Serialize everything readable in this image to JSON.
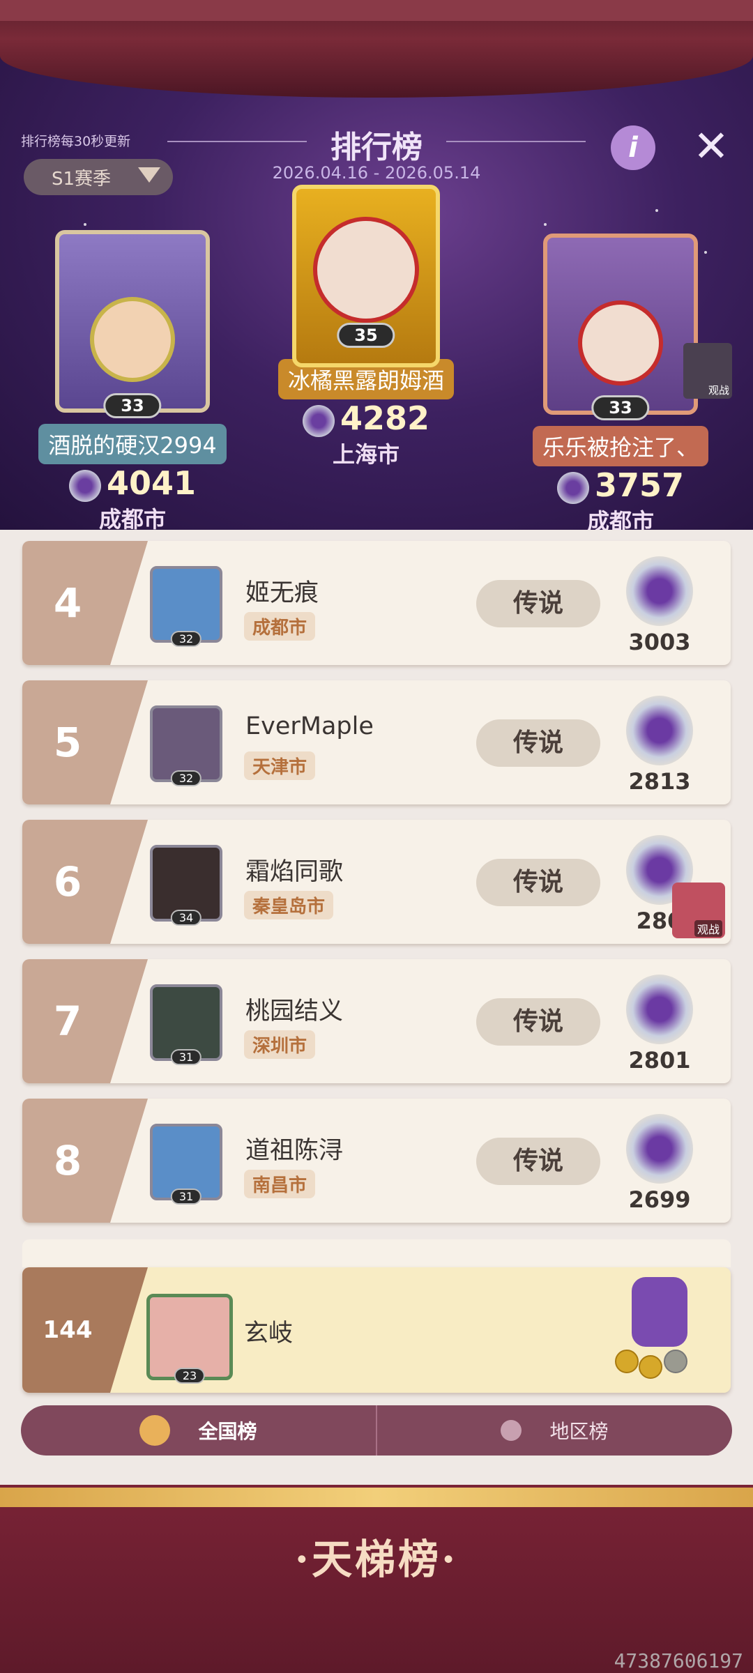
{
  "header": {
    "update_note": "排行榜每30秒更新",
    "season": "S1赛季",
    "title": "排行榜",
    "date_range": "2026.04.16 - 2026.05.14",
    "info_label": "i",
    "close_label": "✕"
  },
  "podium": [
    {
      "rank": "2",
      "name": "酒脱的硬汉2994",
      "level": "33",
      "score": "4041",
      "city": "成都市"
    },
    {
      "rank": "1",
      "name": "冰橘黑露朗姆酒",
      "level": "35",
      "score": "4282",
      "city": "上海市"
    },
    {
      "rank": "3",
      "name": "乐乐被抢注了、",
      "level": "33",
      "score": "3757",
      "city": "成都市",
      "watch_label": "观战"
    }
  ],
  "list": [
    {
      "rank": "4",
      "name": "姬无痕",
      "city": "成都市",
      "level": "32",
      "tier": "传说",
      "score": "3003"
    },
    {
      "rank": "5",
      "name": "EverMaple",
      "city": "天津市",
      "level": "32",
      "tier": "传说",
      "score": "2813"
    },
    {
      "rank": "6",
      "name": "霜焰同歌",
      "city": "秦皇岛市",
      "level": "34",
      "tier": "传说",
      "score": "280",
      "watch_label": "观战"
    },
    {
      "rank": "7",
      "name": "桃园结义",
      "city": "深圳市",
      "level": "31",
      "tier": "传说",
      "score": "2801"
    },
    {
      "rank": "8",
      "name": "道祖陈浔",
      "city": "南昌市",
      "level": "31",
      "tier": "传说",
      "score": "2699"
    }
  ],
  "me": {
    "rank": "144",
    "name": "玄岐",
    "level": "23"
  },
  "tabs": {
    "national": "全国榜",
    "regional": "地区榜"
  },
  "footer": {
    "title": "·天梯榜·"
  },
  "watermark": "47387606197",
  "colors": {
    "accent": "#80485c",
    "gold": "#f2cf7a",
    "row_bg": "#f7f1e8",
    "city_text": "#b5703c"
  }
}
